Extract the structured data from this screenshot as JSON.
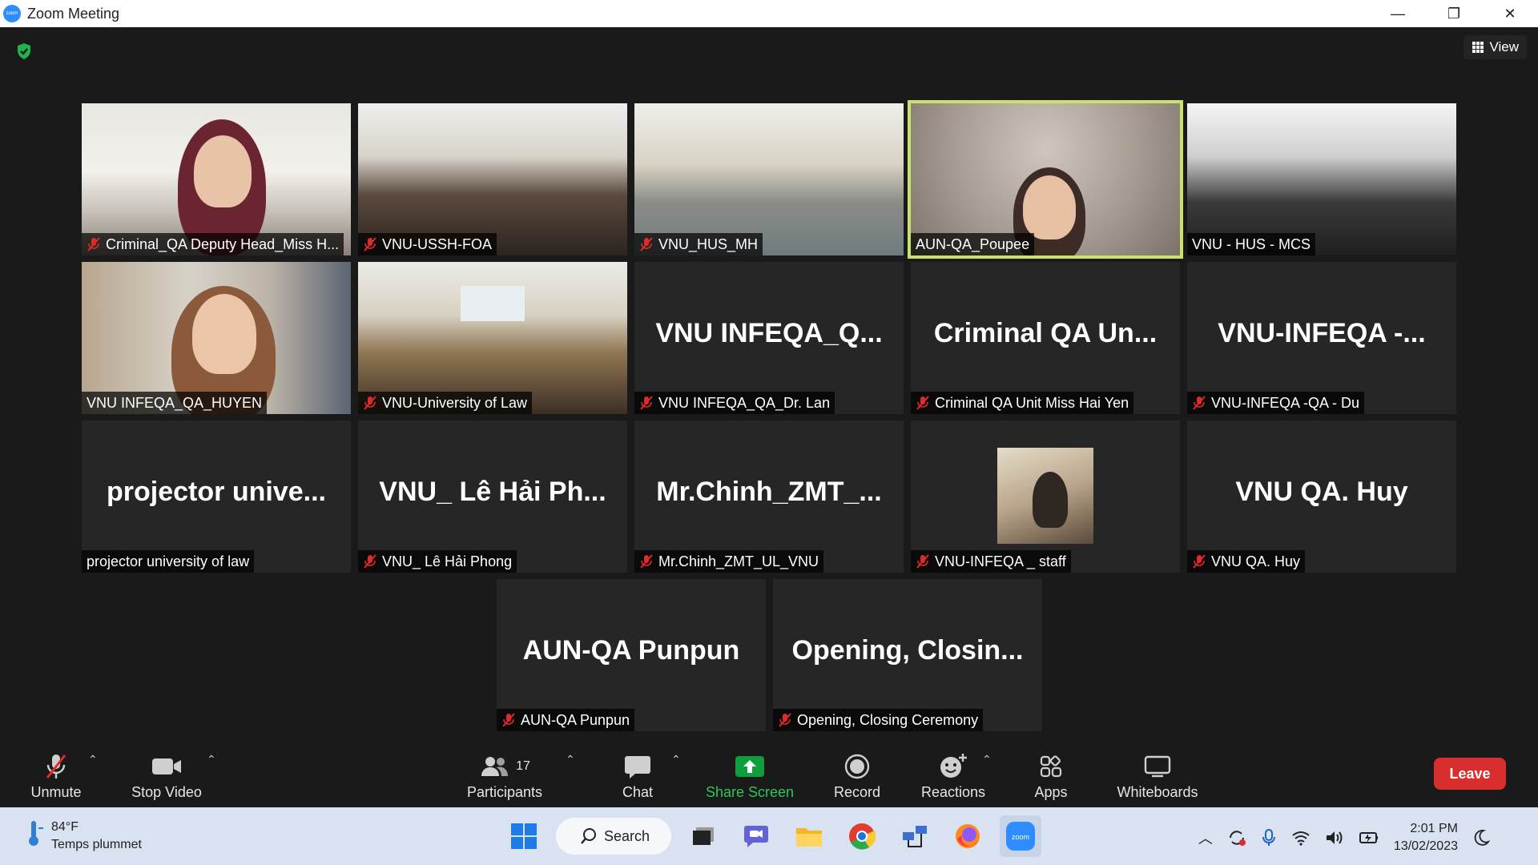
{
  "window": {
    "title": "Zoom Meeting",
    "controls": [
      "—",
      "❐",
      "✕"
    ]
  },
  "meeting": {
    "view_label": "View"
  },
  "tiles": [
    {
      "label": "Criminal_QA Deputy Head_Miss H...",
      "muted": true,
      "video": "office1"
    },
    {
      "label": "VNU-USSH-FOA",
      "muted": true,
      "video": "room1"
    },
    {
      "label": "VNU_HUS_MH",
      "muted": true,
      "video": "room2"
    },
    {
      "label": "AUN-QA_Poupee",
      "muted": false,
      "video": "poupee",
      "active": true
    },
    {
      "label": "VNU - HUS - MCS",
      "muted": false,
      "video": "room3"
    },
    {
      "label": "VNU INFEQA_QA_HUYEN",
      "muted": false,
      "video": "office2"
    },
    {
      "label": "VNU-University of Law",
      "muted": true,
      "video": "room4"
    },
    {
      "big": "VNU  INFEQA_Q...",
      "label": "VNU INFEQA_QA_Dr. Lan",
      "muted": true
    },
    {
      "big": "Criminal  QA  Un...",
      "label": "Criminal QA Unit Miss Hai Yen",
      "muted": true
    },
    {
      "big": "VNU-INFEQA  -...",
      "label": "VNU-INFEQA -QA - Du",
      "muted": true
    },
    {
      "big": "projector  unive...",
      "label": "projector university of law",
      "muted": false
    },
    {
      "big": "VNU_  Lê  Hải  Ph...",
      "label": "VNU_ Lê Hải Phong",
      "muted": true
    },
    {
      "big": "Mr.Chinh_ZMT_...",
      "label": "Mr.Chinh_ZMT_UL_VNU",
      "muted": true
    },
    {
      "label": "VNU-INFEQA _ staff",
      "muted": true,
      "avatar": true
    },
    {
      "big": "VNU QA. Huy",
      "label": "VNU QA. Huy",
      "muted": true
    },
    {
      "big": "AUN-QA Punpun",
      "label": "AUN-QA Punpun",
      "muted": true
    },
    {
      "big": "Opening,  Closin...",
      "label": "Opening, Closing Ceremony",
      "muted": true
    }
  ],
  "toolbar": {
    "unmute": "Unmute",
    "stop_video": "Stop Video",
    "participants": "Participants",
    "participants_count": "17",
    "chat": "Chat",
    "share_screen": "Share Screen",
    "record": "Record",
    "reactions": "Reactions",
    "apps": "Apps",
    "whiteboards": "Whiteboards",
    "leave": "Leave"
  },
  "taskbar": {
    "weather_temp": "84°F",
    "weather_desc": "Temps plummet",
    "search": "Search",
    "time": "2:01 PM",
    "date": "13/02/2023"
  },
  "colors": {
    "active_border": "#c9e26a",
    "leave": "#d92e2e",
    "share": "#0e9f3c"
  }
}
